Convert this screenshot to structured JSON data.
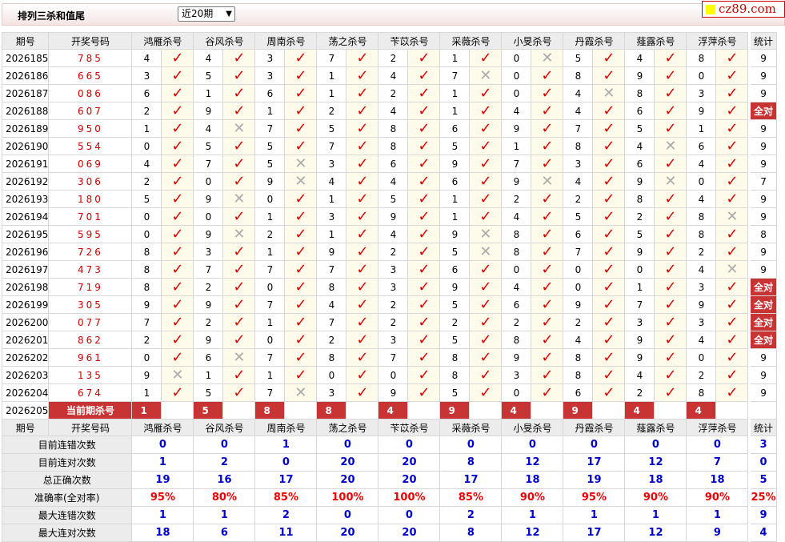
{
  "header": {
    "title": "排列三杀和值尾",
    "period_select": "近20期",
    "logo": "cz89.com"
  },
  "columns": {
    "period": "期号",
    "number": "开奖号码",
    "experts": [
      "鸿雁杀号",
      "谷风杀号",
      "周南杀号",
      "荡之杀号",
      "苄苡杀号",
      "采薇杀号",
      "小旻杀号",
      "丹霞杀号",
      "薤露杀号",
      "浮萍杀号"
    ],
    "count": "统计"
  },
  "rows": [
    {
      "period": "2026185",
      "number": "785",
      "values": [
        4,
        4,
        3,
        7,
        2,
        1,
        0,
        5,
        4,
        8
      ],
      "marks": [
        "ok",
        "ok",
        "ok",
        "ok",
        "ok",
        "ok",
        "bad",
        "ok",
        "ok",
        "ok"
      ],
      "count": "9"
    },
    {
      "period": "2026186",
      "number": "665",
      "values": [
        3,
        5,
        3,
        1,
        4,
        7,
        0,
        8,
        9,
        0
      ],
      "marks": [
        "ok",
        "ok",
        "ok",
        "ok",
        "ok",
        "bad",
        "ok",
        "ok",
        "ok",
        "ok"
      ],
      "count": "9"
    },
    {
      "period": "2026187",
      "number": "086",
      "values": [
        6,
        1,
        6,
        1,
        2,
        1,
        0,
        4,
        8,
        3
      ],
      "marks": [
        "ok",
        "ok",
        "ok",
        "ok",
        "ok",
        "ok",
        "ok",
        "bad",
        "ok",
        "ok"
      ],
      "count": "9"
    },
    {
      "period": "2026188",
      "number": "607",
      "values": [
        2,
        9,
        1,
        2,
        4,
        1,
        4,
        4,
        6,
        9
      ],
      "marks": [
        "ok",
        "ok",
        "ok",
        "ok",
        "ok",
        "ok",
        "ok",
        "ok",
        "ok",
        "ok"
      ],
      "count": "全对"
    },
    {
      "period": "2026189",
      "number": "950",
      "values": [
        1,
        4,
        7,
        5,
        8,
        6,
        9,
        7,
        5,
        1
      ],
      "marks": [
        "ok",
        "bad",
        "ok",
        "ok",
        "ok",
        "ok",
        "ok",
        "ok",
        "ok",
        "ok"
      ],
      "count": "9"
    },
    {
      "period": "2026190",
      "number": "554",
      "values": [
        0,
        5,
        5,
        7,
        8,
        5,
        1,
        8,
        4,
        6
      ],
      "marks": [
        "ok",
        "ok",
        "ok",
        "ok",
        "ok",
        "ok",
        "ok",
        "ok",
        "bad",
        "ok"
      ],
      "count": "9"
    },
    {
      "period": "2026191",
      "number": "069",
      "values": [
        4,
        7,
        5,
        3,
        6,
        9,
        7,
        3,
        6,
        4
      ],
      "marks": [
        "ok",
        "ok",
        "bad",
        "ok",
        "ok",
        "ok",
        "ok",
        "ok",
        "ok",
        "ok"
      ],
      "count": "9"
    },
    {
      "period": "2026192",
      "number": "306",
      "values": [
        2,
        0,
        9,
        4,
        4,
        6,
        9,
        4,
        9,
        0
      ],
      "marks": [
        "ok",
        "ok",
        "bad",
        "ok",
        "ok",
        "ok",
        "bad",
        "ok",
        "bad",
        "ok"
      ],
      "count": "7"
    },
    {
      "period": "2026193",
      "number": "180",
      "values": [
        5,
        9,
        0,
        1,
        5,
        1,
        2,
        2,
        8,
        4
      ],
      "marks": [
        "ok",
        "bad",
        "ok",
        "ok",
        "ok",
        "ok",
        "ok",
        "ok",
        "ok",
        "ok"
      ],
      "count": "9"
    },
    {
      "period": "2026194",
      "number": "701",
      "values": [
        0,
        0,
        1,
        3,
        9,
        1,
        4,
        5,
        2,
        8
      ],
      "marks": [
        "ok",
        "ok",
        "ok",
        "ok",
        "ok",
        "ok",
        "ok",
        "ok",
        "ok",
        "bad"
      ],
      "count": "9"
    },
    {
      "period": "2026195",
      "number": "595",
      "values": [
        0,
        9,
        2,
        1,
        4,
        9,
        8,
        6,
        5,
        8
      ],
      "marks": [
        "ok",
        "bad",
        "ok",
        "ok",
        "ok",
        "bad",
        "ok",
        "ok",
        "ok",
        "ok"
      ],
      "count": "8"
    },
    {
      "period": "2026196",
      "number": "726",
      "values": [
        8,
        3,
        1,
        9,
        2,
        5,
        8,
        7,
        9,
        2
      ],
      "marks": [
        "ok",
        "ok",
        "ok",
        "ok",
        "ok",
        "bad",
        "ok",
        "ok",
        "ok",
        "ok"
      ],
      "count": "9"
    },
    {
      "period": "2026197",
      "number": "473",
      "values": [
        8,
        7,
        7,
        7,
        3,
        6,
        0,
        0,
        0,
        4
      ],
      "marks": [
        "ok",
        "ok",
        "ok",
        "ok",
        "ok",
        "ok",
        "ok",
        "ok",
        "ok",
        "bad"
      ],
      "count": "9"
    },
    {
      "period": "2026198",
      "number": "719",
      "values": [
        8,
        2,
        0,
        8,
        3,
        9,
        4,
        0,
        1,
        3
      ],
      "marks": [
        "ok",
        "ok",
        "ok",
        "ok",
        "ok",
        "ok",
        "ok",
        "ok",
        "ok",
        "ok"
      ],
      "count": "全对"
    },
    {
      "period": "2026199",
      "number": "305",
      "values": [
        9,
        9,
        7,
        4,
        2,
        5,
        6,
        9,
        7,
        9
      ],
      "marks": [
        "ok",
        "ok",
        "ok",
        "ok",
        "ok",
        "ok",
        "ok",
        "ok",
        "ok",
        "ok"
      ],
      "count": "全对"
    },
    {
      "period": "2026200",
      "number": "077",
      "values": [
        7,
        2,
        1,
        7,
        2,
        2,
        2,
        2,
        3,
        3
      ],
      "marks": [
        "ok",
        "ok",
        "ok",
        "ok",
        "ok",
        "ok",
        "ok",
        "ok",
        "ok",
        "ok"
      ],
      "count": "全对"
    },
    {
      "period": "2026201",
      "number": "862",
      "values": [
        2,
        9,
        0,
        2,
        3,
        5,
        8,
        4,
        9,
        4
      ],
      "marks": [
        "ok",
        "ok",
        "ok",
        "ok",
        "ok",
        "ok",
        "ok",
        "ok",
        "ok",
        "ok"
      ],
      "count": "全对"
    },
    {
      "period": "2026202",
      "number": "961",
      "values": [
        0,
        6,
        7,
        8,
        7,
        8,
        9,
        8,
        9,
        0
      ],
      "marks": [
        "ok",
        "bad",
        "ok",
        "ok",
        "ok",
        "ok",
        "ok",
        "ok",
        "ok",
        "ok"
      ],
      "count": "9"
    },
    {
      "period": "2026203",
      "number": "135",
      "values": [
        9,
        1,
        1,
        0,
        0,
        8,
        3,
        8,
        4,
        2
      ],
      "marks": [
        "bad",
        "ok",
        "ok",
        "ok",
        "ok",
        "ok",
        "ok",
        "ok",
        "ok",
        "ok"
      ],
      "count": "9"
    },
    {
      "period": "2026204",
      "number": "674",
      "values": [
        1,
        5,
        7,
        3,
        9,
        5,
        0,
        6,
        2,
        8
      ],
      "marks": [
        "ok",
        "ok",
        "bad",
        "ok",
        "ok",
        "ok",
        "ok",
        "ok",
        "ok",
        "ok"
      ],
      "count": "9"
    }
  ],
  "current": {
    "period": "2026205",
    "label": "当前期杀号",
    "values": [
      "1",
      "5",
      "8",
      "8",
      "4",
      "9",
      "4",
      "9",
      "4",
      "4"
    ]
  },
  "stats": [
    {
      "label": "目前连错次数",
      "values": [
        "0",
        "0",
        "1",
        "0",
        "0",
        "0",
        "0",
        "0",
        "0",
        "0"
      ],
      "count": "3"
    },
    {
      "label": "目前连对次数",
      "values": [
        "1",
        "2",
        "0",
        "20",
        "20",
        "8",
        "12",
        "17",
        "12",
        "7"
      ],
      "count": "0"
    },
    {
      "label": "总正确次数",
      "values": [
        "19",
        "16",
        "17",
        "20",
        "20",
        "17",
        "18",
        "19",
        "18",
        "18"
      ],
      "count": "5"
    },
    {
      "label": "准确率(全对率)",
      "values": [
        "95%",
        "80%",
        "85%",
        "100%",
        "100%",
        "85%",
        "90%",
        "95%",
        "90%",
        "90%"
      ],
      "count": "25%"
    },
    {
      "label": "最大连错次数",
      "values": [
        "1",
        "1",
        "2",
        "0",
        "0",
        "2",
        "1",
        "1",
        "1",
        "1"
      ],
      "count": "9"
    },
    {
      "label": "最大连对次数",
      "values": [
        "18",
        "6",
        "11",
        "20",
        "20",
        "8",
        "12",
        "17",
        "12",
        "9"
      ],
      "count": "4"
    }
  ],
  "symbols": {
    "ok": "✓",
    "bad": "✕"
  },
  "colors": {
    "ok": "#dd0000",
    "bad": "#aaaaaa",
    "highlight": "#c83434",
    "stat_value": "#0000cc",
    "stat_pct": "#ee0000"
  }
}
